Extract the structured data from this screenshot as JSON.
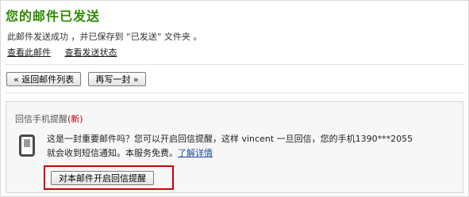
{
  "header": {
    "title": "您的邮件已发送"
  },
  "status": {
    "message": "此邮件发送成功 ，并已保存到 “已发送” 文件夹 。"
  },
  "links": {
    "view_mail": "查看此邮件",
    "view_status": "查看发送状态"
  },
  "buttons": {
    "back_to_list": "« 返回邮件列表",
    "write_another": "再写一封 »"
  },
  "reminder": {
    "title": "回信手机提醒",
    "new_badge": "(新)",
    "line1": "这是一封重要邮件吗？您可以开启回信提醒，这样 vincent 一旦回信，您的手机1390***2055",
    "line2": "就会收到短信通知。本服务免费。",
    "learn_more": "了解详情",
    "enable_button": "对本邮件开启回信提醒",
    "icon": "mobile-phone-icon"
  },
  "colors": {
    "title_green": "#2e8a00",
    "new_red": "#c00000",
    "highlight_red": "#d00000"
  }
}
